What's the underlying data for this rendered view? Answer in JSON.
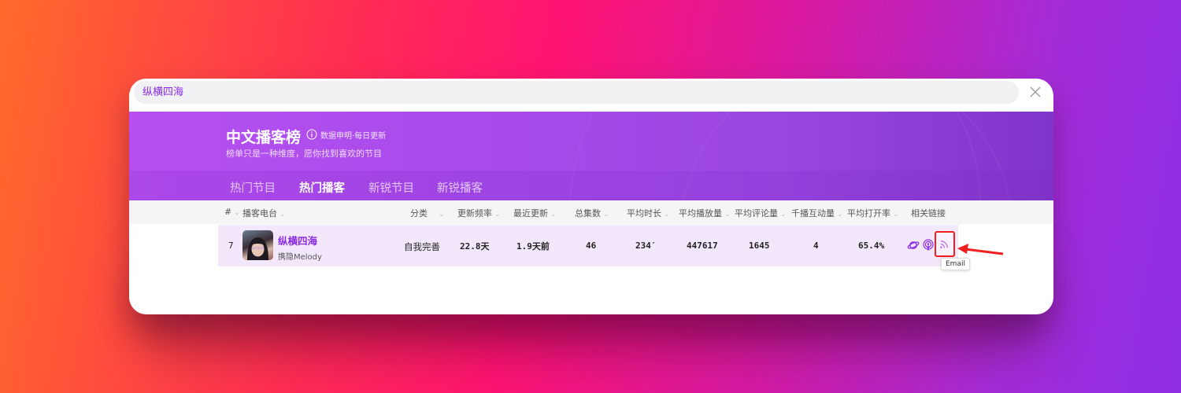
{
  "search": {
    "value": "纵横四海"
  },
  "banner": {
    "title": "中文播客榜",
    "note": "数据申明·每日更新",
    "subtitle": "榜单只是一种维度，愿你找到喜欢的节目"
  },
  "tabs": [
    {
      "label": "热门节目",
      "active": false
    },
    {
      "label": "热门播客",
      "active": true
    },
    {
      "label": "新锐节目",
      "active": false
    },
    {
      "label": "新锐播客",
      "active": false
    }
  ],
  "table": {
    "headers": {
      "rank": "#",
      "station": "播客电台",
      "category": "分类",
      "frequency": "更新频率",
      "latest": "最近更新",
      "episodes": "总集数",
      "duration": "平均时长",
      "plays": "平均播放量",
      "comments": "平均评论量",
      "interaction": "千播互动量",
      "open_rate": "平均打开率",
      "links": "相关链接"
    },
    "rows": [
      {
        "rank": "7",
        "name": "纵横四海",
        "author": "携隐Melody",
        "category": "自我完善",
        "frequency": "22.8天",
        "latest": "1.9天前",
        "episodes": "46",
        "duration": "234′",
        "plays": "447617",
        "comments": "1645",
        "interaction": "4",
        "open_rate": "65.4%"
      }
    ]
  },
  "tooltip": {
    "text": "Email"
  },
  "icons": {
    "close": "close-icon",
    "info": "info-icon",
    "links": [
      "planet-icon",
      "podcast-icon",
      "rss-icon"
    ]
  },
  "colors": {
    "accent": "#8a2be2",
    "banner_start": "#b84ff0",
    "banner_end": "#7f35c9",
    "row_highlight": "#f3e8fb",
    "annotation_red": "#f02020"
  }
}
